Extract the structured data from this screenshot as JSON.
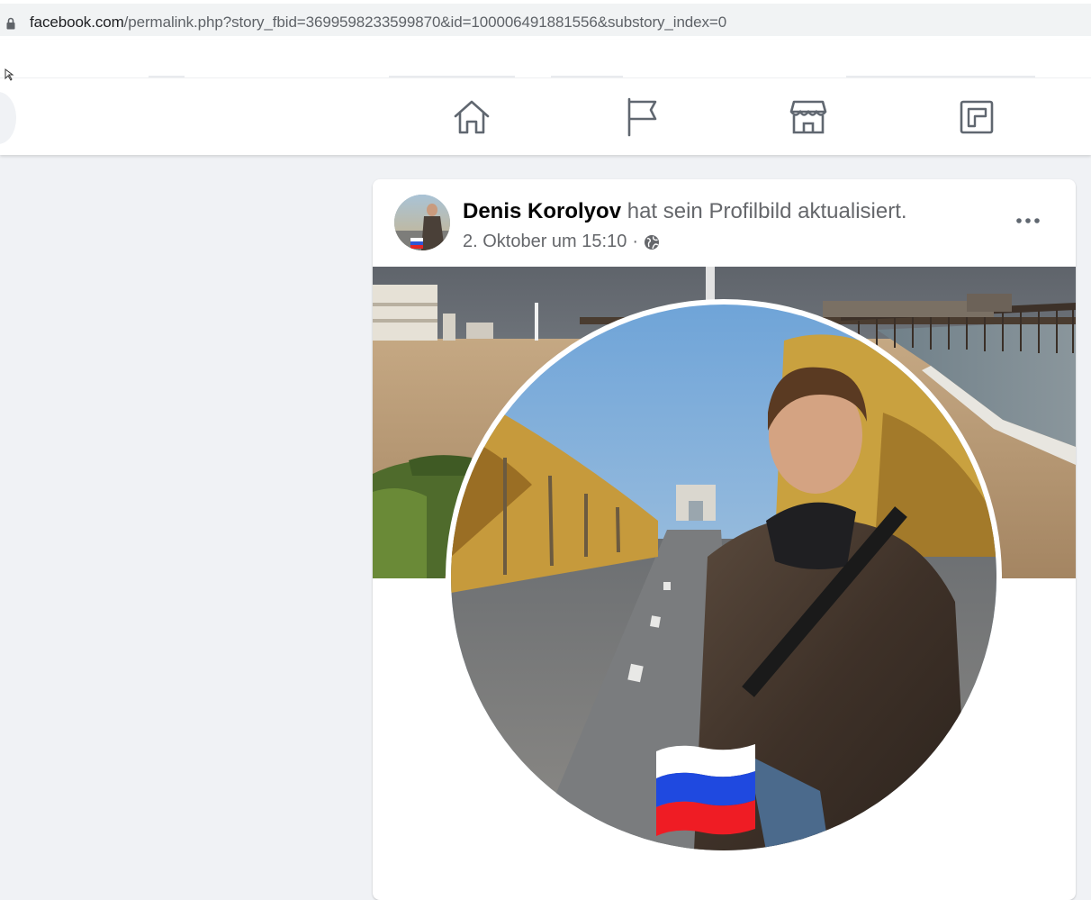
{
  "browser": {
    "url_host": "facebook.com",
    "url_path": "/permalink.php?story_fbid=3699598233599870&id=100006491881556&substory_index=0"
  },
  "nav": {
    "icons": [
      "home-icon",
      "pages-flag-icon",
      "marketplace-store-icon",
      "gaming-icon"
    ]
  },
  "post": {
    "author": "Denis Korolyov",
    "action": " hat sein Profilbild aktualisiert.",
    "timestamp": "2. Oktober um 15:10",
    "separator": "·",
    "audience_icon": "globe-icon",
    "more_icon": "more-options-icon",
    "profile_badge": "russia-flag"
  },
  "colors": {
    "page_bg": "#f0f2f5",
    "card_bg": "#ffffff",
    "secondary_text": "#65676b",
    "primary_text": "#050505"
  }
}
